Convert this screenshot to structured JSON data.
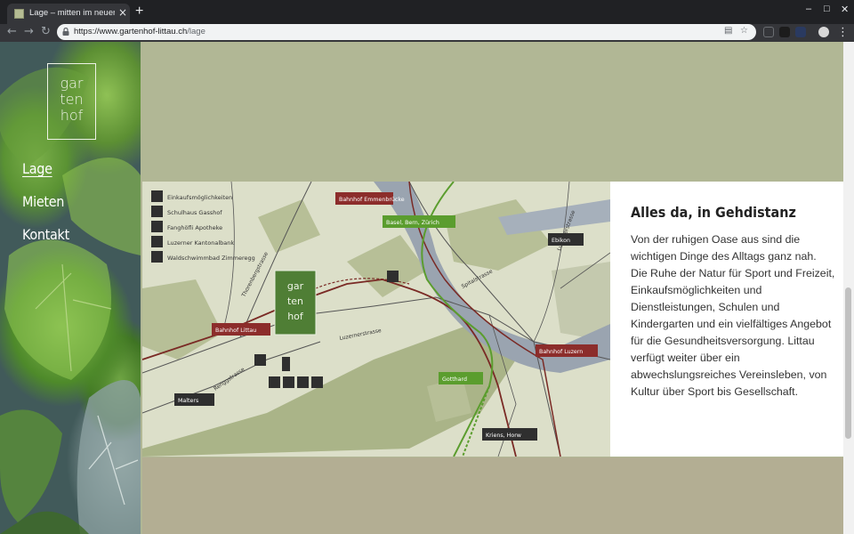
{
  "browser": {
    "tab_title": "Lage – mitten im neuen Dorfzentrum",
    "tab_close": "×",
    "new_tab": "+",
    "url_host": "https://www.gartenhof-littau.ch",
    "url_path": "/lage",
    "win_minimize": "–",
    "win_maximize": "□",
    "win_close": "✕"
  },
  "sidebar": {
    "logo_lines": [
      "gar",
      "ten",
      "hof"
    ],
    "menu": [
      {
        "label": "Lage",
        "active": true
      },
      {
        "label": "Mieten",
        "active": false
      },
      {
        "label": "Kontakt",
        "active": false
      }
    ]
  },
  "map": {
    "legend": [
      {
        "icon": "cart-icon",
        "label": "Einkaufsmöglichkeiten"
      },
      {
        "icon": "flag-icon",
        "label": "Schulhaus Gasshof"
      },
      {
        "icon": "pharmacy-icon",
        "label": "Fanghöfli Apotheke"
      },
      {
        "icon": "bank-icon",
        "label": "Luzerner Kantonalbank"
      },
      {
        "icon": "swim-icon",
        "label": "Waldschwimmbad Zimmeregg"
      }
    ],
    "stations": [
      "Bahnhof Emmenbrücke",
      "Bahnhof Littau",
      "Bahnhof Luzern"
    ],
    "motorway": [
      "Basel, Bern, Zürich",
      "Gotthard"
    ],
    "directions": [
      "Ebikon",
      "Malters",
      "Kriens, Horw"
    ],
    "streets": [
      "Thorenbergstrasse",
      "Luzernerstrasse",
      "Spitalstrasse",
      "Luzernerstrasse",
      "Renggstrasse"
    ],
    "logo_lines": [
      "gar",
      "ten",
      "hof"
    ],
    "colors": {
      "land": "#dcdfc9",
      "built": "#aab488",
      "water": "#9aa4b0",
      "rail": "#7a2a25",
      "motorway": "#5b9d2e",
      "station": "#8c2d2b",
      "dark_label": "#2f2f2f"
    }
  },
  "article": {
    "heading": "Alles da, in Gehdistanz",
    "body": "Von der ruhigen Oase aus sind die wichtigen Dinge des Alltags ganz nah. Die Ruhe der Natur für Sport und Freizeit, Einkaufsmöglichkeiten und Dienstleistungen, Schulen und Kindergarten und ein vielfältiges Angebot für die Gesundheitsversorgung. Littau verfügt weiter über ein abwechslungsreiches Vereinsleben, von Kultur über Sport bis Gesellschaft."
  }
}
